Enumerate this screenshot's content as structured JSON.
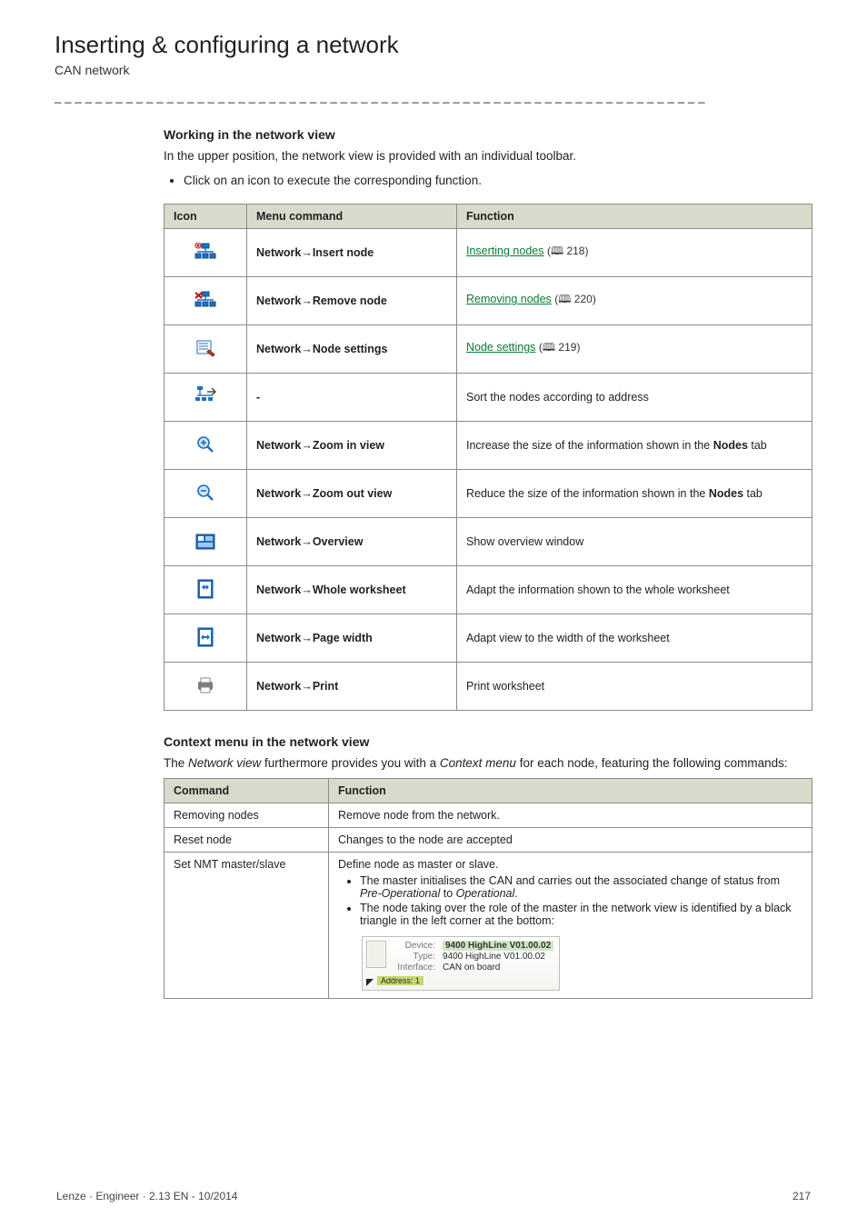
{
  "header": {
    "title": "Inserting & configuring a network",
    "subtitle": "CAN network",
    "dashline": "_ _ _ _ _ _ _ _ _ _ _ _ _ _ _ _ _ _ _ _ _ _ _ _ _ _ _ _ _ _ _ _ _ _ _ _ _ _ _ _ _ _ _ _ _ _ _ _ _ _ _ _ _ _ _ _ _ _ _ _ _ _ _ _"
  },
  "working": {
    "heading": "Working in the network view",
    "intro": "In the upper position, the network view is provided with an individual toolbar.",
    "bullet": "Click on an icon to execute the corresponding function."
  },
  "icons_table": {
    "headers": {
      "icon": "Icon",
      "menu": "Menu command",
      "func": "Function"
    },
    "rows": [
      {
        "icon": "insert-node",
        "menu_pre": "Network",
        "menu_post": "Insert node",
        "func_link": "Inserting nodes",
        "func_page": "218"
      },
      {
        "icon": "remove-node",
        "menu_pre": "Network",
        "menu_post": "Remove node",
        "func_link": "Removing nodes",
        "func_page": "220"
      },
      {
        "icon": "node-settings",
        "menu_pre": "Network",
        "menu_post": "Node settings",
        "func_link": "Node settings",
        "func_page": "219"
      },
      {
        "icon": "sort-address",
        "menu_plain": "-",
        "func_text": "Sort the nodes according to address"
      },
      {
        "icon": "zoom-in",
        "menu_pre": "Network",
        "menu_post": "Zoom in view",
        "func_text_pre": "Increase the size of the information shown in the ",
        "func_text_bold": "Nodes",
        "func_text_post": " tab"
      },
      {
        "icon": "zoom-out",
        "menu_pre": "Network",
        "menu_post": "Zoom out view",
        "func_text_pre": "Reduce the size of the information shown in the ",
        "func_text_bold": "Nodes",
        "func_text_post": " tab"
      },
      {
        "icon": "overview",
        "menu_pre": "Network",
        "menu_post": "Overview",
        "func_text": "Show overview window"
      },
      {
        "icon": "whole-sheet",
        "menu_pre": "Network",
        "menu_post": "Whole worksheet",
        "func_text": "Adapt the information shown to the whole worksheet"
      },
      {
        "icon": "page-width",
        "menu_pre": "Network",
        "menu_post": "Page width",
        "func_text": "Adapt view to the width of the worksheet"
      },
      {
        "icon": "print",
        "menu_pre": "Network",
        "menu_post": "Print",
        "func_text": "Print worksheet"
      }
    ]
  },
  "context": {
    "heading": "Context menu in the network view",
    "intro_1": "The ",
    "intro_em1": "Network view",
    "intro_2": " furthermore provides you with a ",
    "intro_em2": "Context menu",
    "intro_3": " for each node, featuring the following commands:",
    "headers": {
      "cmd": "Command",
      "func": "Function"
    },
    "rows": {
      "r0": {
        "cmd": "Removing nodes",
        "func": "Remove node from the network."
      },
      "r1": {
        "cmd": "Reset node",
        "func": "Changes to the node are accepted"
      },
      "r2": {
        "cmd": "Set NMT master/slave",
        "line1": "Define node as master or slave.",
        "b1a": "The master initialises the CAN and carries out the associated change of status from ",
        "b1em1": "Pre-Operational",
        "b1mid": " to ",
        "b1em2": "Operational",
        "b1end": ".",
        "b2": "The node taking over the role of the master in the network view is identified by a black triangle in the left corner at the bottom:",
        "shot": {
          "device_label": "Device:",
          "device_val": "9400 HighLine V01.00.02",
          "type_label": "Type:",
          "type_val": "9400 HighLine V01.00.02",
          "iface_label": "Interface:",
          "iface_val": "CAN on board",
          "addr_label": "Address:",
          "addr_val": "1"
        }
      }
    }
  },
  "footer": {
    "left": "Lenze · Engineer · 2.13 EN - 10/2014",
    "right": "217"
  }
}
